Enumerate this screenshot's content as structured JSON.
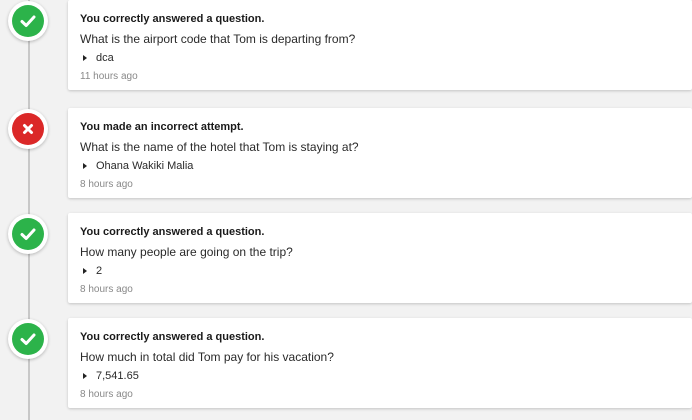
{
  "entries": [
    {
      "status": "correct",
      "title": "You correctly answered a question.",
      "question": "What is the airport code that Tom is departing from?",
      "answer": "dca",
      "time": "11 hours ago"
    },
    {
      "status": "incorrect",
      "title": "You made an incorrect attempt.",
      "question": "What is the name of the hotel that Tom is staying at?",
      "answer": "Ohana Wakiki Malia",
      "time": "8 hours ago"
    },
    {
      "status": "correct",
      "title": "You correctly answered a question.",
      "question": "How many people are going on the trip?",
      "answer": "2",
      "time": "8 hours ago"
    },
    {
      "status": "correct",
      "title": "You correctly answered a question.",
      "question": "How much in total did Tom pay for his vacation?",
      "answer": "7,541.65",
      "time": "8 hours ago"
    }
  ],
  "colors": {
    "correct": "#2cb34a",
    "incorrect": "#db2828",
    "background": "#f2f2f2",
    "timeline_line": "#c8c8c8"
  },
  "icons": {
    "correct": "checkmark-icon",
    "incorrect": "x-mark-icon",
    "answer": "caret-right-icon"
  }
}
